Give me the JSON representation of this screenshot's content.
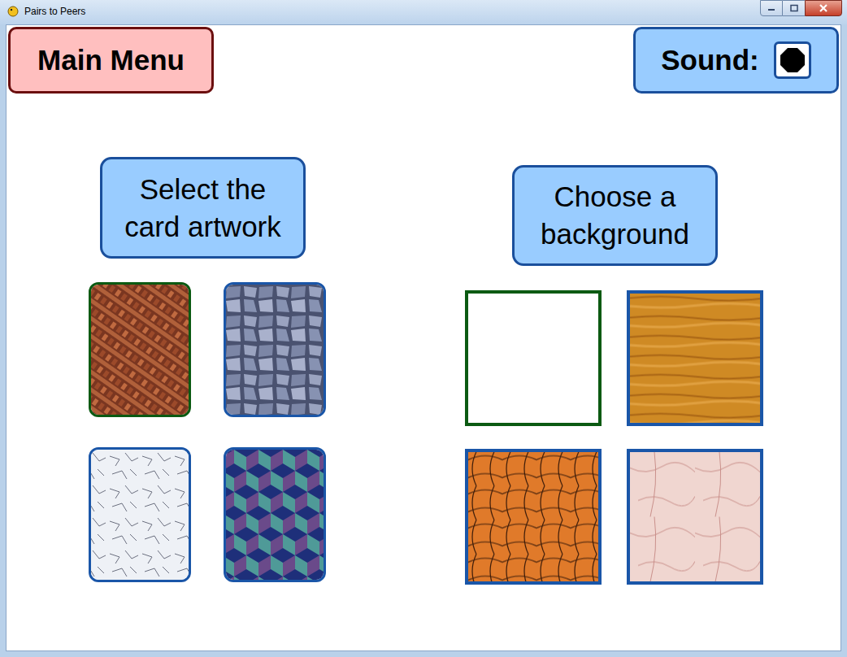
{
  "window": {
    "title": "Pairs to Peers"
  },
  "main_menu": {
    "label": "Main Menu"
  },
  "sound": {
    "label": "Sound:",
    "on": true
  },
  "card_artwork": {
    "heading": "Select the card artwork",
    "cards": [
      {
        "kind": "weave",
        "selected": true
      },
      {
        "kind": "stone",
        "selected": false
      },
      {
        "kind": "ice",
        "selected": false
      },
      {
        "kind": "cubes",
        "selected": false
      }
    ]
  },
  "background": {
    "heading": "Choose a background",
    "options": [
      {
        "kind": "plain",
        "selected": true
      },
      {
        "kind": "wood",
        "selected": false
      },
      {
        "kind": "basket",
        "selected": false
      },
      {
        "kind": "marble",
        "selected": false
      }
    ]
  }
}
